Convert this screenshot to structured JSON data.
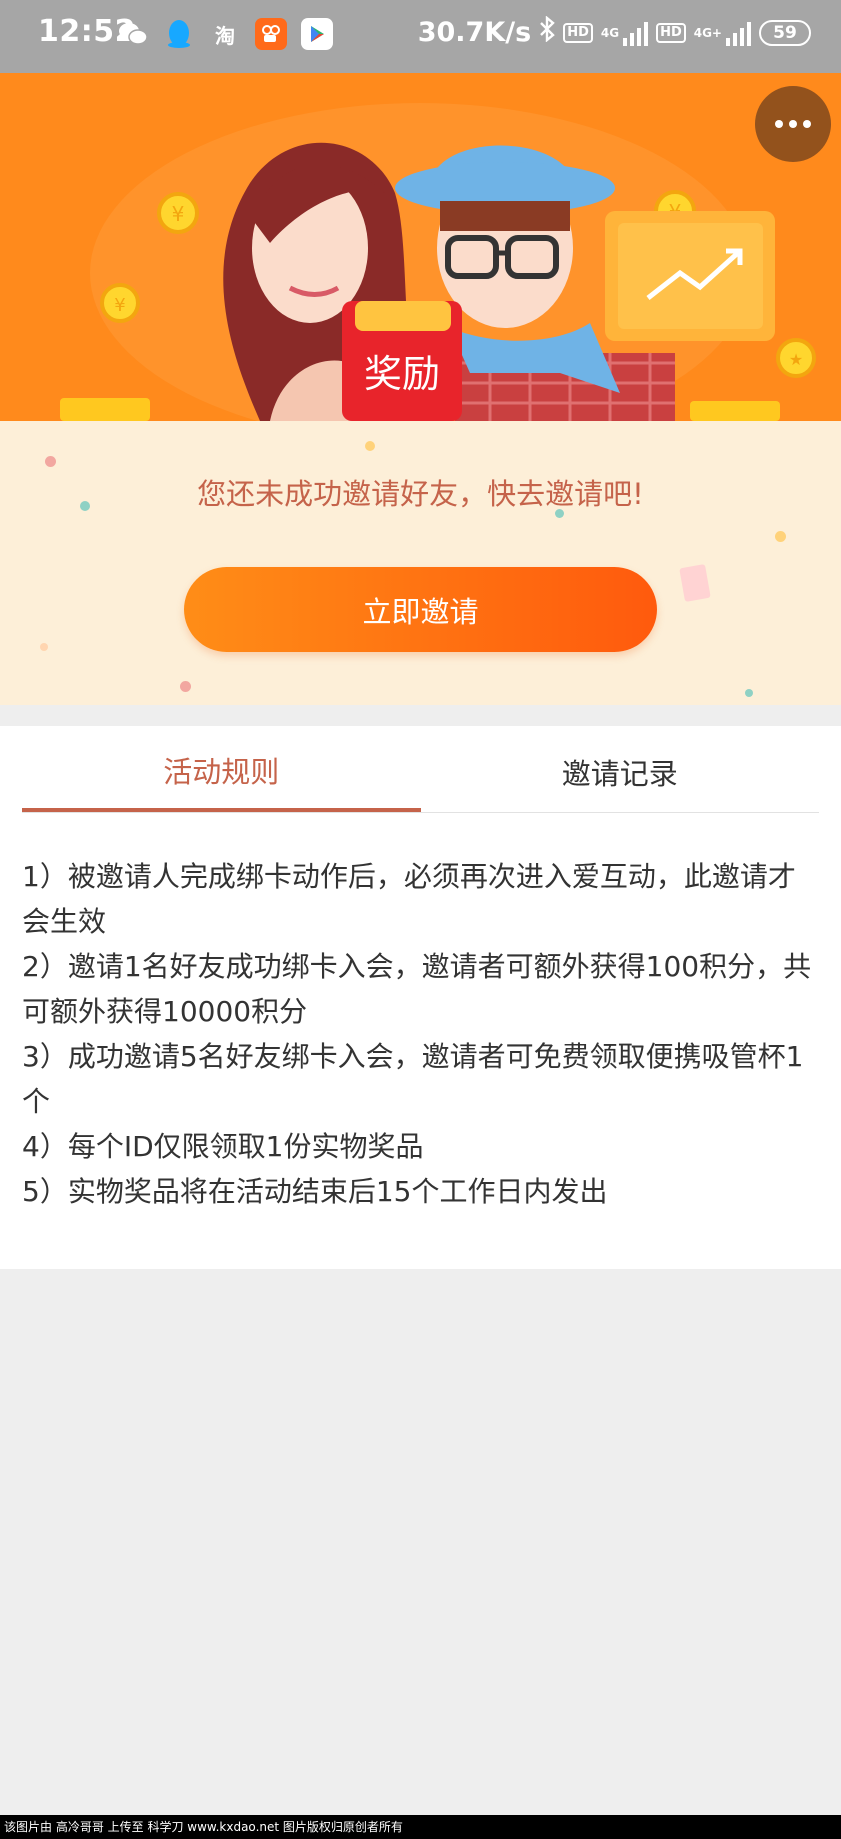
{
  "status_bar": {
    "time": "12:52",
    "app_icons": [
      {
        "name": "wechat-icon",
        "glyph": "✉",
        "color": "#a6a6a6"
      },
      {
        "name": "qq-icon",
        "glyph": "●",
        "color": "#17a8ff"
      },
      {
        "name": "taobao-icon",
        "glyph": "淘",
        "color": "#a6a6a6"
      },
      {
        "name": "kuaishou-icon",
        "glyph": "▶",
        "color": "#ff6a1a"
      },
      {
        "name": "play-store-icon",
        "glyph": "▶",
        "color": "#ffffff"
      }
    ],
    "net_speed": "30.7K/s",
    "network_1": "4G",
    "network_2": "4G+",
    "hd_label": "HD",
    "battery": "59"
  },
  "banner": {
    "red_packet_text": "奖励"
  },
  "invite": {
    "message": "您还未成功邀请好友，快去邀请吧!",
    "button_label": "立即邀请"
  },
  "tabs": {
    "rules_label": "活动规则",
    "records_label": "邀请记录"
  },
  "rules": [
    "1）被邀请人完成绑卡动作后，必须再次进入爱互动，此邀请才会生效",
    "2）邀请1名好友成功绑卡入会，邀请者可额外获得100积分，共可额外获得10000积分",
    "3）成功邀请5名好友绑卡入会，邀请者可免费领取便携吸管杯1个",
    "4）每个ID仅限领取1份实物奖品",
    "5）实物奖品将在活动结束后15个工作日内发出"
  ],
  "footer": {
    "watermark": "该图片由 高冷哥哥 上传至 科学刀 www.kxdao.net 图片版权归原创者所有"
  },
  "colors": {
    "accent": "#c5634a",
    "banner_bg": "#ff8a1c",
    "invite_bg": "#fdefd8",
    "button_start": "#ff8d17",
    "button_end": "#ff5a0d"
  }
}
